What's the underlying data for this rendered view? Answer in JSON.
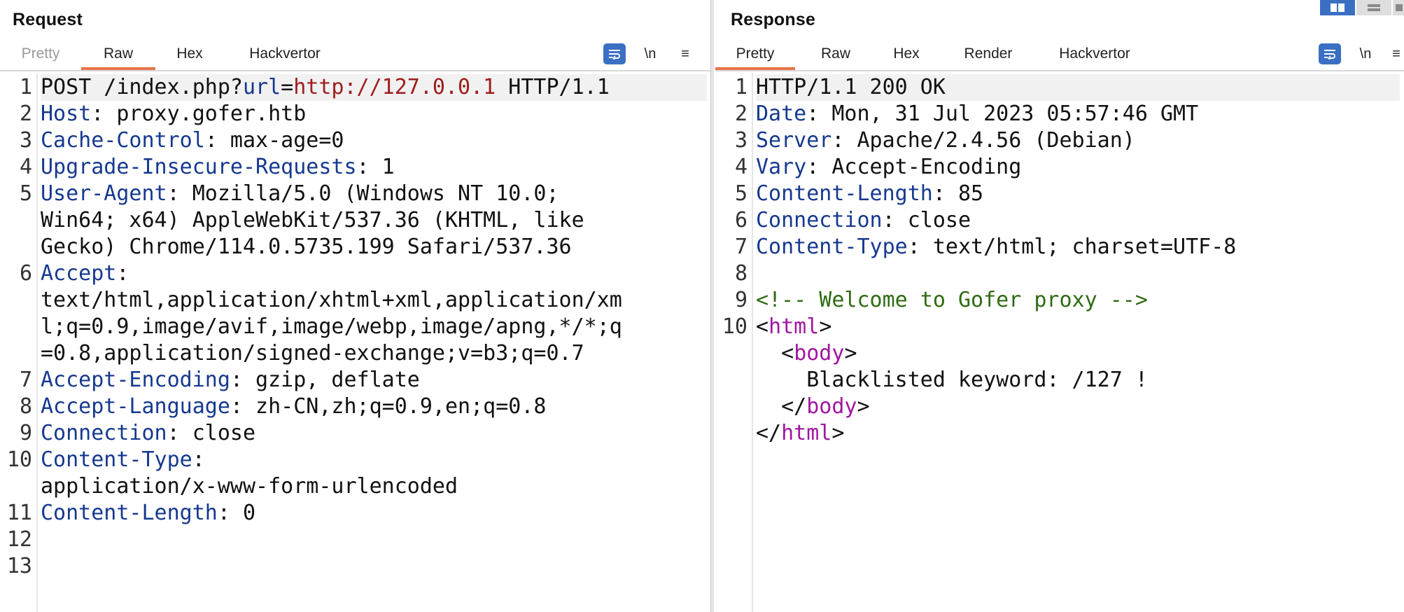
{
  "request": {
    "title": "Request",
    "tabs": [
      "Pretty",
      "Raw",
      "Hex",
      "Hackvertor"
    ],
    "active_tab": "Raw",
    "toolbar": {
      "newline_label": "\\n",
      "menu_label": "≡"
    },
    "lines": [
      {
        "n": "1",
        "parts": [
          {
            "t": "POST /index.php?",
            "c": ""
          },
          {
            "t": "url",
            "c": "k"
          },
          {
            "t": "=",
            "c": ""
          },
          {
            "t": "http://127.0.0.1",
            "c": "u"
          },
          {
            "t": " HTTP/1.1",
            "c": ""
          }
        ],
        "hl": true
      },
      {
        "n": "2",
        "parts": [
          {
            "t": "Host",
            "c": "k"
          },
          {
            "t": ": proxy.gofer.htb",
            "c": ""
          }
        ]
      },
      {
        "n": "3",
        "parts": [
          {
            "t": "Cache-Control",
            "c": "k"
          },
          {
            "t": ": max-age=0",
            "c": ""
          }
        ]
      },
      {
        "n": "4",
        "parts": [
          {
            "t": "Upgrade-Insecure-Requests",
            "c": "k"
          },
          {
            "t": ": 1",
            "c": ""
          }
        ]
      },
      {
        "n": "5",
        "parts": [
          {
            "t": "User-Agent",
            "c": "k"
          },
          {
            "t": ": Mozilla/5.0 (Windows NT 10.0;",
            "c": ""
          }
        ]
      },
      {
        "n": "",
        "parts": [
          {
            "t": "Win64; x64) AppleWebKit/537.36 (KHTML, like",
            "c": ""
          }
        ]
      },
      {
        "n": "",
        "parts": [
          {
            "t": "Gecko) Chrome/114.0.5735.199 Safari/537.36",
            "c": ""
          }
        ]
      },
      {
        "n": "6",
        "parts": [
          {
            "t": "Accept",
            "c": "k"
          },
          {
            "t": ":",
            "c": ""
          }
        ]
      },
      {
        "n": "",
        "parts": [
          {
            "t": "text/html,application/xhtml+xml,application/xm",
            "c": ""
          }
        ]
      },
      {
        "n": "",
        "parts": [
          {
            "t": "l;q=0.9,image/avif,image/webp,image/apng,*/*;q",
            "c": ""
          }
        ]
      },
      {
        "n": "",
        "parts": [
          {
            "t": "=0.8,application/signed-exchange;v=b3;q=0.7",
            "c": ""
          }
        ]
      },
      {
        "n": "7",
        "parts": [
          {
            "t": "Accept-Encoding",
            "c": "k"
          },
          {
            "t": ": gzip, deflate",
            "c": ""
          }
        ]
      },
      {
        "n": "8",
        "parts": [
          {
            "t": "Accept-Language",
            "c": "k"
          },
          {
            "t": ": zh-CN,zh;q=0.9,en;q=0.8",
            "c": ""
          }
        ]
      },
      {
        "n": "9",
        "parts": [
          {
            "t": "Connection",
            "c": "k"
          },
          {
            "t": ": close",
            "c": ""
          }
        ]
      },
      {
        "n": "10",
        "parts": [
          {
            "t": "Content-Type",
            "c": "k"
          },
          {
            "t": ":",
            "c": ""
          }
        ]
      },
      {
        "n": "",
        "parts": [
          {
            "t": "application/x-www-form-urlencoded",
            "c": ""
          }
        ]
      },
      {
        "n": "11",
        "parts": [
          {
            "t": "Content-Length",
            "c": "k"
          },
          {
            "t": ": 0",
            "c": ""
          }
        ]
      },
      {
        "n": "12",
        "parts": []
      },
      {
        "n": "13",
        "parts": []
      }
    ]
  },
  "response": {
    "title": "Response",
    "tabs": [
      "Pretty",
      "Raw",
      "Hex",
      "Render",
      "Hackvertor"
    ],
    "active_tab": "Pretty",
    "toolbar": {
      "newline_label": "\\n",
      "menu_label": "≡"
    },
    "lines": [
      {
        "n": "1",
        "parts": [
          {
            "t": "HTTP/1.1 200 OK",
            "c": ""
          }
        ],
        "hl": true
      },
      {
        "n": "2",
        "parts": [
          {
            "t": "Date",
            "c": "k"
          },
          {
            "t": ": Mon, 31 Jul 2023 05:57:46 GMT",
            "c": ""
          }
        ]
      },
      {
        "n": "3",
        "parts": [
          {
            "t": "Server",
            "c": "k"
          },
          {
            "t": ": Apache/2.4.56 (Debian)",
            "c": ""
          }
        ]
      },
      {
        "n": "4",
        "parts": [
          {
            "t": "Vary",
            "c": "k"
          },
          {
            "t": ": Accept-Encoding",
            "c": ""
          }
        ]
      },
      {
        "n": "5",
        "parts": [
          {
            "t": "Content-Length",
            "c": "k"
          },
          {
            "t": ": 85",
            "c": ""
          }
        ]
      },
      {
        "n": "6",
        "parts": [
          {
            "t": "Connection",
            "c": "k"
          },
          {
            "t": ": close",
            "c": ""
          }
        ]
      },
      {
        "n": "7",
        "parts": [
          {
            "t": "Content-Type",
            "c": "k"
          },
          {
            "t": ": text/html; charset=UTF-8",
            "c": ""
          }
        ]
      },
      {
        "n": "8",
        "parts": []
      },
      {
        "n": "9",
        "parts": [
          {
            "t": "<!-- Welcome to Gofer proxy -->",
            "c": "c"
          }
        ]
      },
      {
        "n": "10",
        "parts": [
          {
            "t": "<",
            "c": ""
          },
          {
            "t": "html",
            "c": "t"
          },
          {
            "t": ">",
            "c": ""
          }
        ]
      },
      {
        "n": "",
        "parts": [
          {
            "t": "  <",
            "c": ""
          },
          {
            "t": "body",
            "c": "t"
          },
          {
            "t": ">",
            "c": ""
          }
        ]
      },
      {
        "n": "",
        "parts": [
          {
            "t": "    Blacklisted keyword: /127 !",
            "c": ""
          }
        ]
      },
      {
        "n": "",
        "parts": [
          {
            "t": "  </",
            "c": ""
          },
          {
            "t": "body",
            "c": "t"
          },
          {
            "t": ">",
            "c": ""
          }
        ]
      },
      {
        "n": "",
        "parts": [
          {
            "t": "</",
            "c": ""
          },
          {
            "t": "html",
            "c": "t"
          },
          {
            "t": ">",
            "c": ""
          }
        ]
      }
    ]
  },
  "colors": {
    "header_key": "#16398f",
    "url_value": "#a01c1c",
    "comment": "#2f6b12",
    "tag": "#a016a0",
    "active_tab_underline": "#e8734a",
    "toolbar_active": "#3b6fc4"
  }
}
